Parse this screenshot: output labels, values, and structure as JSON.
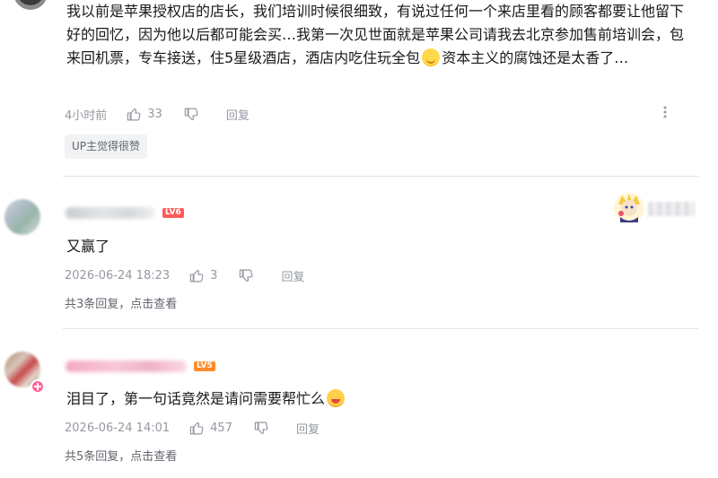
{
  "comments": [
    {
      "text_before_emoji": "我以前是苹果授权店的店长，我们培训时候很细致，有说过任何一个来店里看的顾客都要让他留下好的回忆，因为他以后都可能会买…我第一次见世面就是苹果公司请我去北京参加售前培训会，包来回机票，专车接送，住5星级酒店，酒店内吃住玩全包",
      "emoji": "smile-emoji",
      "text_after_emoji": "资本主义的腐蚀还是太香了…",
      "time": "4小时前",
      "likes": "33",
      "reply_label": "回复",
      "tag": "UP主觉得很赞"
    },
    {
      "level": "LV6",
      "text": "又赢了",
      "time": "2026-06-24 18:23",
      "likes": "3",
      "reply_label": "回复",
      "replies_text": "共3条回复，",
      "view_text": "点击查看"
    },
    {
      "level": "LV5",
      "text_before_emoji": "泪目了，第一句话竟然是请问需要帮忙么",
      "emoji": "crying-emoji",
      "time": "2026-06-24 14:01",
      "likes": "457",
      "reply_label": "回复",
      "replies_text": "共5条回复，",
      "view_text": "点击查看"
    }
  ],
  "colors": {
    "text": "#18191c",
    "meta": "#9499a0",
    "divider": "#e3e5e7",
    "lv6": "#ff5b5b",
    "lv5": "#ff8b2b",
    "uname_pink": "#fb7299"
  }
}
